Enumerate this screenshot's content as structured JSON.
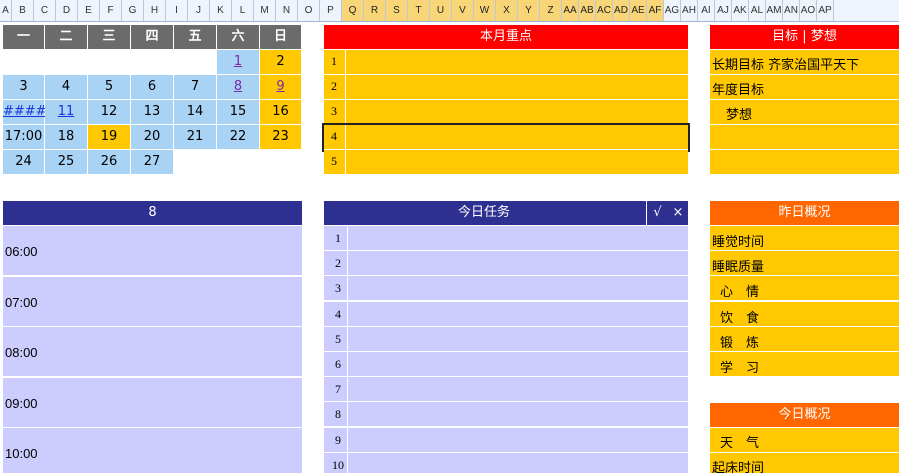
{
  "column_headers": [
    "A",
    "B",
    "C",
    "D",
    "E",
    "F",
    "G",
    "H",
    "I",
    "J",
    "K",
    "L",
    "M",
    "N",
    "O",
    "P",
    "Q",
    "R",
    "S",
    "T",
    "U",
    "V",
    "W",
    "X",
    "Y",
    "Z",
    "AA",
    "AB",
    "AC",
    "AD",
    "AE",
    "AF",
    "AG",
    "AH",
    "AI",
    "AJ",
    "AK",
    "AL",
    "AM",
    "AN",
    "AO",
    "AP"
  ],
  "calendar": {
    "weekdays": [
      "一",
      "二",
      "三",
      "四",
      "五",
      "六",
      "日"
    ],
    "rows": [
      [
        "",
        "",
        "",
        "",
        "",
        "1",
        "2"
      ],
      [
        "3",
        "4",
        "5",
        "6",
        "7",
        "8",
        "9"
      ],
      [
        "####",
        "11",
        "12",
        "13",
        "14",
        "15",
        "16"
      ],
      [
        "17:00",
        "18",
        "19",
        "20",
        "21",
        "22",
        "23"
      ],
      [
        "24",
        "25",
        "26",
        "27",
        "",
        "",
        ""
      ]
    ]
  },
  "month_focus": {
    "title": "本月重点",
    "rows": [
      "1",
      "2",
      "3",
      "4",
      "5"
    ]
  },
  "goals": {
    "title": "目标 | 梦想",
    "rows": [
      "长期目标  齐家治国平天下",
      "年度目标",
      "梦想",
      "",
      ""
    ]
  },
  "schedule": {
    "title": "8",
    "times": [
      "06:00",
      "07:00",
      "08:00",
      "09:00",
      "10:00"
    ]
  },
  "today_tasks": {
    "title": "今日任务",
    "check_label": "√",
    "cross_label": "×",
    "rows": [
      "1",
      "2",
      "3",
      "4",
      "5",
      "6",
      "7",
      "8",
      "9",
      "10"
    ]
  },
  "yesterday": {
    "title": "昨日概况",
    "rows": [
      "睡觉时间",
      "睡眠质量",
      "心　情",
      "饮　食",
      "锻　炼",
      "学　习"
    ]
  },
  "today_overview": {
    "title": "今日概况",
    "rows": [
      "天　气",
      "起床时间"
    ]
  },
  "colors": {
    "red": "#ff0000",
    "navy": "#2e3091",
    "orange": "#ff6600",
    "gold": "#ffc800",
    "lavender": "#ccccff",
    "calendar_blue": "#a9d3f5"
  }
}
